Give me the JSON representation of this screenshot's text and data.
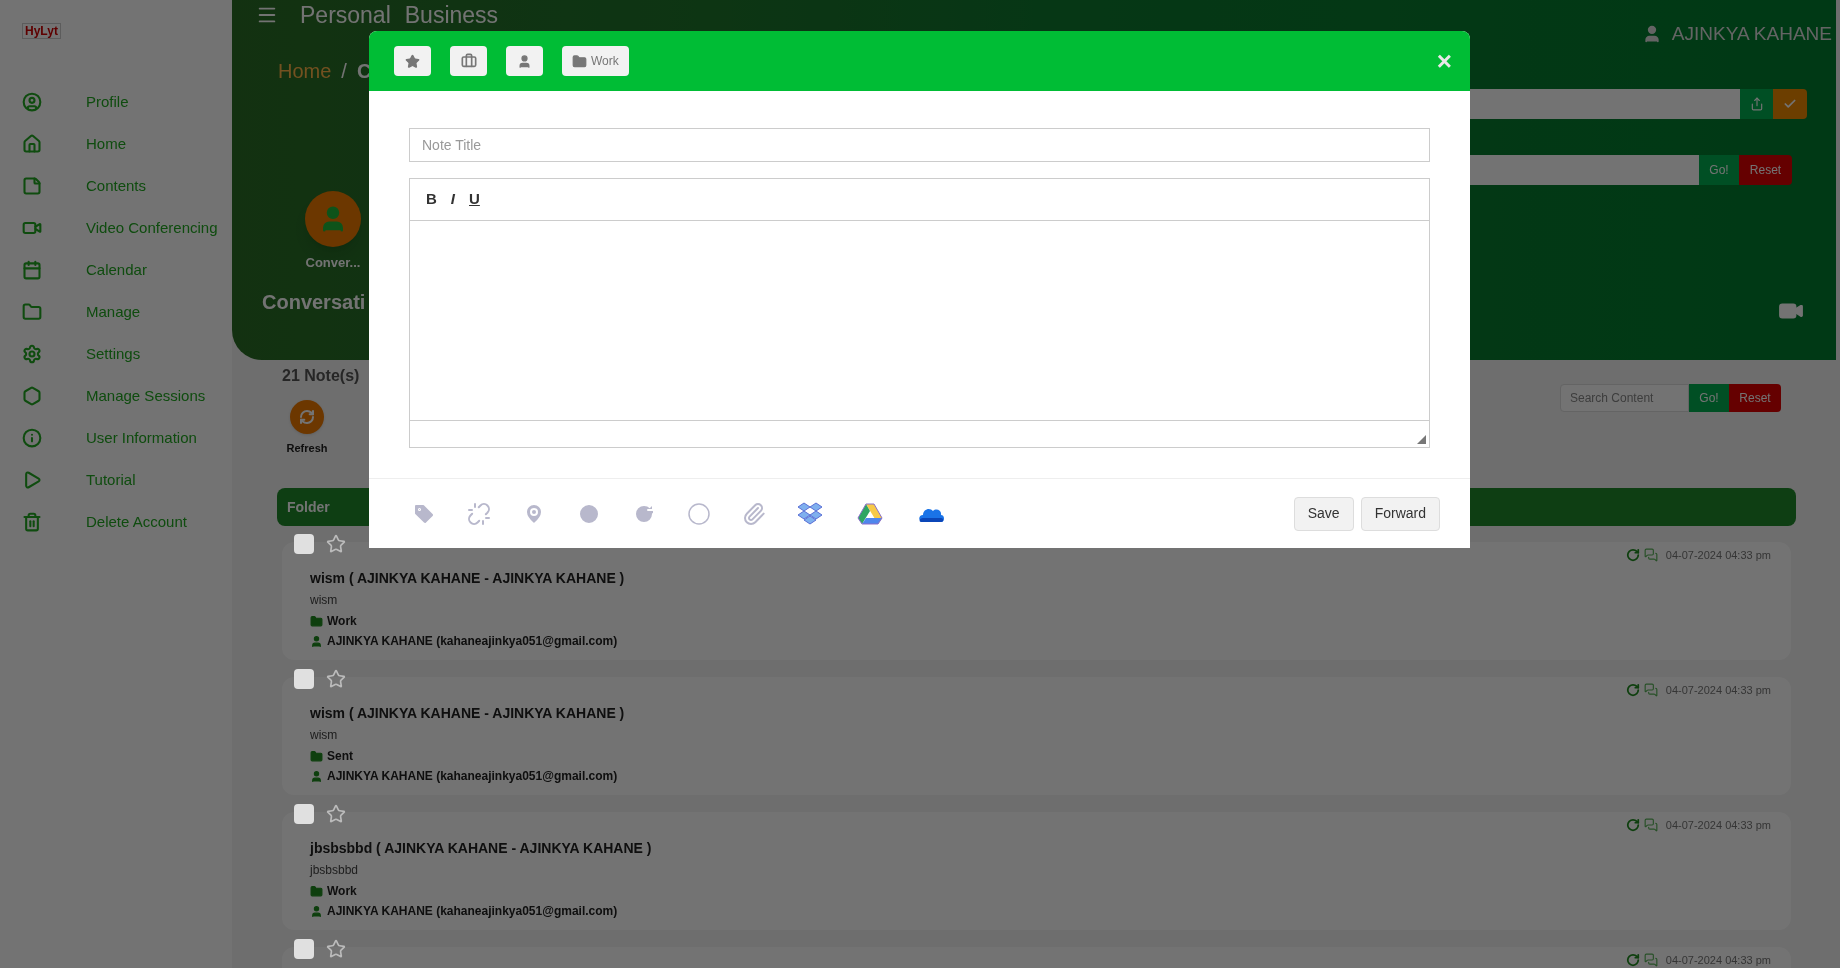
{
  "logo": {
    "text": "HyLyt"
  },
  "sidebar": {
    "items": [
      {
        "label": "Profile"
      },
      {
        "label": "Home"
      },
      {
        "label": "Contents"
      },
      {
        "label": "Video Conferencing"
      },
      {
        "label": "Calendar"
      },
      {
        "label": "Manage"
      },
      {
        "label": "Settings"
      },
      {
        "label": "Manage Sessions"
      },
      {
        "label": "User Information"
      },
      {
        "label": "Tutorial"
      },
      {
        "label": "Delete Account"
      }
    ]
  },
  "header": {
    "title_parts": [
      "Personal",
      "Business"
    ],
    "breadcrumb": [
      "Home",
      "/",
      "C"
    ],
    "user": "AJINKYA KAHANE",
    "shortcut_label": "Conver...",
    "section_title": "Conversati",
    "filter_go": "Go!",
    "filter_reset": "Reset"
  },
  "notes_count": "21 Note(s)",
  "refresh_label": "Refresh",
  "search": {
    "placeholder": "Search Content",
    "go": "Go!",
    "reset": "Reset"
  },
  "folder_bar": {
    "label": "Folder"
  },
  "notes": [
    {
      "checked": false,
      "starred": false,
      "title": "wism ( AJINKYA KAHANE - AJINKYA KAHANE )",
      "body": "wism",
      "folder": "Work",
      "owner": "AJINKYA KAHANE (kahaneajinkya051@gmail.com)",
      "time": "04-07-2024 04:33 pm"
    },
    {
      "checked": false,
      "starred": false,
      "title": "wism ( AJINKYA KAHANE - AJINKYA KAHANE )",
      "body": "wism",
      "folder": "Sent",
      "owner": "AJINKYA KAHANE (kahaneajinkya051@gmail.com)",
      "time": "04-07-2024 04:33 pm"
    },
    {
      "checked": false,
      "starred": false,
      "title": "jbsbsbbd ( AJINKYA KAHANE - AJINKYA KAHANE )",
      "body": "jbsbsbbd",
      "folder": "Work",
      "owner": "AJINKYA KAHANE (kahaneajinkya051@gmail.com)",
      "time": "04-07-2024 04:33 pm"
    },
    {
      "checked": false,
      "starred": false,
      "time": "04-07-2024 04:33 pm"
    }
  ],
  "modal": {
    "folder_button": "Work",
    "close": "×",
    "title_placeholder": "Note Title",
    "format_buttons": [
      "B",
      "I",
      "U"
    ],
    "save": "Save",
    "forward": "Forward"
  }
}
